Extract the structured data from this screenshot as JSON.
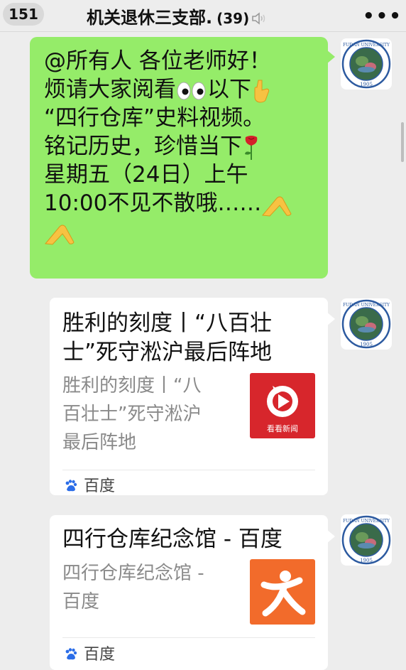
{
  "header": {
    "unread_count": "151",
    "chat_title": "机关退休三支部.",
    "member_count": "(39)",
    "more_icon": "ellipsis-icon"
  },
  "messages": {
    "green_message": {
      "lines": [
        "@所有人 各位老师好！",
        "烦请大家阅看",
        "以下",
        "“四行仓库”史料视频。",
        "铭记历史，珍惜当下",
        "星期五（24日）上午",
        "10:00不见不散哦……"
      ]
    },
    "card1": {
      "title_lines": [
        "胜利的刻度丨“八百壮",
        "士”死守淞沪最后阵地"
      ],
      "desc_lines": [
        "胜利的刻度丨“八",
        "百壮士”死守淞沪",
        "最后阵地"
      ],
      "source": "百度",
      "thumb_label": "看看新闻"
    },
    "card2": {
      "title": "四行仓库纪念馆 - 百度",
      "desc_lines": [
        "四行仓库纪念馆 -",
        "百度"
      ],
      "source": "百度"
    }
  },
  "avatar": {
    "text_top": "FUDAN UNIVERSITY",
    "year": "1905"
  },
  "colors": {
    "bubble": "#95ec69",
    "background": "#ededed",
    "thumb1": "#d7262c",
    "thumb2": "#f26b2b"
  }
}
